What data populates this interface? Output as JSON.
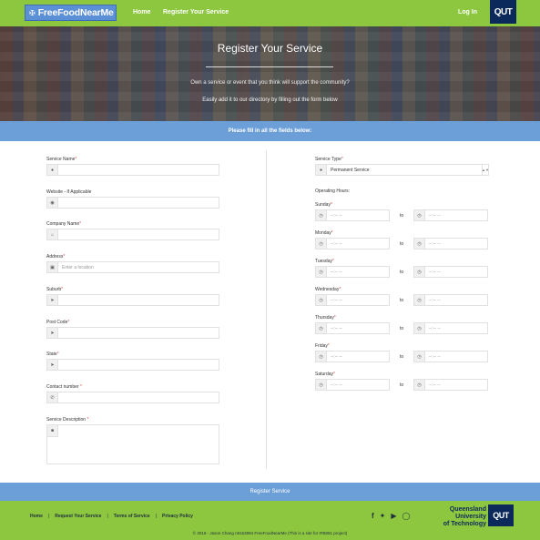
{
  "nav": {
    "brand": "FreeFoodNearMe",
    "brand_icon": "utensils-icon",
    "links": [
      "Home",
      "Register Your Service"
    ],
    "login": "Log In",
    "logo": "QUT"
  },
  "hero": {
    "title": "Register Your Service",
    "line1": "Own a service or event that you think will support the community?",
    "line2": "Easily add it to our directory by filling out the form below"
  },
  "instruction": "Please fill in all the fields below:",
  "form_left": {
    "service_name": {
      "label": "Service Name",
      "required": "*",
      "icon": "user-icon",
      "value": ""
    },
    "website": {
      "label": "Website - If Applicable",
      "required": "",
      "icon": "globe-icon",
      "value": ""
    },
    "company": {
      "label": "Company Name",
      "required": "*",
      "icon": "home-icon",
      "value": ""
    },
    "address": {
      "label": "Address",
      "required": "*",
      "icon": "calendar-icon",
      "placeholder": "Enter a location"
    },
    "suburb": {
      "label": "Suburb",
      "required": "*",
      "icon": "location-arrow-icon",
      "value": ""
    },
    "post_code": {
      "label": "Post Code",
      "required": "*",
      "icon": "location-arrow-icon",
      "value": ""
    },
    "state": {
      "label": "State",
      "required": "*",
      "icon": "location-arrow-icon",
      "value": ""
    },
    "contact": {
      "label": "Contact number ",
      "required": "*",
      "icon": "phone-icon",
      "value": ""
    },
    "description": {
      "label": "Service Description ",
      "required": "*",
      "icon": "comment-icon",
      "value": ""
    }
  },
  "form_right": {
    "service_type": {
      "label": "Service Type",
      "required": "*",
      "icon": "user-icon",
      "selected": "Permanent Service"
    },
    "operating_hours_label": "Operating Hours:",
    "time_placeholder": "--:-- --",
    "to_label": "to",
    "clock_icon": "clock-icon",
    "days": [
      {
        "label": "Sunday",
        "required": "*"
      },
      {
        "label": "Monday",
        "required": "*"
      },
      {
        "label": "Tuesday",
        "required": "*"
      },
      {
        "label": "Wednesday",
        "required": "*"
      },
      {
        "label": "Thursday",
        "required": "*"
      },
      {
        "label": "Friday",
        "required": "*"
      },
      {
        "label": "Saturday",
        "required": "*"
      }
    ]
  },
  "submit": "Register Service",
  "footer": {
    "links": [
      "Home",
      "Request Your Service",
      "Terms of Service",
      "Privacy Policy"
    ],
    "separator": "|",
    "social": [
      "facebook-icon",
      "twitter-icon",
      "youtube-icon",
      "instagram-icon"
    ],
    "qut_text": [
      "Queensland",
      "University",
      "of Technology"
    ],
    "logo": "QUT",
    "copyright": "© 2018 - Jason Chang n9163994 FreeFoodNearMe (This is a site for IFB881 project)"
  },
  "colors": {
    "nav_green": "#8dc63f",
    "accent_blue": "#6c9fd8",
    "qut_navy": "#0b2a5b",
    "required_red": "#d9534f"
  }
}
